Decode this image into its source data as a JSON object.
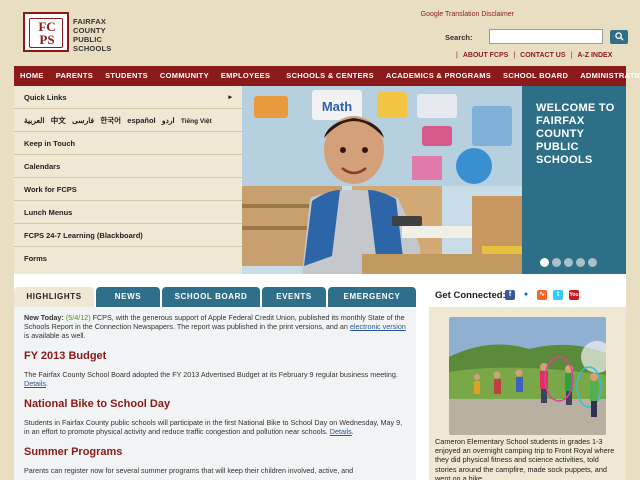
{
  "header": {
    "logo_letters": "FC\nPS",
    "logo_text_lines": [
      "FAIRFAX",
      "COUNTY",
      "PUBLIC",
      "SCHOOLS"
    ],
    "translation_disclaimer": "Google Translation Disclaimer",
    "search_label": "Search:",
    "search_value": "",
    "top_links": [
      "ABOUT FCPS",
      "CONTACT US",
      "A-Z INDEX"
    ]
  },
  "nav": {
    "items_left": [
      "HOME",
      "PARENTS",
      "STUDENTS",
      "COMMUNITY",
      "EMPLOYEES"
    ],
    "items_right": [
      "SCHOOLS & CENTERS",
      "ACADEMICS & PROGRAMS",
      "SCHOOL BOARD",
      "ADMINISTRATION"
    ]
  },
  "left_menu": {
    "quick_links": "Quick Links",
    "languages": [
      "العربية",
      "中文",
      "فارسی",
      "한국어",
      "español",
      "اردو",
      "Tiếng Việt"
    ],
    "items": [
      "Keep in Touch",
      "Calendars",
      "Work for FCPS",
      "Lunch Menus",
      "FCPS 24-7 Learning (Blackboard)",
      "Forms"
    ]
  },
  "hero": {
    "welcome_line1": "WELCOME TO",
    "welcome_line2": "FAIRFAX COUNTY",
    "welcome_line3": "PUBLIC SCHOOLS",
    "math_sign": "Math",
    "slide_count": 5,
    "active_slide": 1
  },
  "tabs": [
    "HIGHLIGHTS",
    "NEWS",
    "SCHOOL BOARD",
    "EVENTS",
    "EMERGENCY"
  ],
  "news": {
    "today_label": "New Today:",
    "today_date": "(5/4/12)",
    "today_text": " FCPS, with the generous support of Apple Federal Credit Union, published its monthly State of the Schools Report in the Connection Newspapers. The report was published in the print versions, and an ",
    "today_link": "electronic version",
    "today_tail": " is available as well.",
    "items": [
      {
        "title": "FY 2013 Budget",
        "text": "The Fairfax County School Board adopted the FY 2013 Advertised Budget at its February 9 regular business meeting.",
        "link": "Details"
      },
      {
        "title": "National Bike to School Day",
        "text": "Students in Fairfax County public schools will participate in the first  National Bike to School Day on Wednesday, May 9, in an effort to promote physical activity and reduce traffic congestion and pollution near schools.",
        "link": "Details"
      },
      {
        "title": "Summer Programs",
        "text": "Parents can register now for several summer programs that will keep their children involved, active, and",
        "link": ""
      }
    ]
  },
  "right": {
    "get_connected": "Get Connected:",
    "caption": "Cameron Elementary School students in grades 1-3 enjoyed an overnight camping trip to Front Royal where they did physical fitness and science activities, told stories around the campfire, made sock puppets, and went on a hike."
  },
  "colors": {
    "brand_red": "#8b1a1a",
    "teal": "#2f6f8a",
    "tan": "#e8dfc2"
  }
}
